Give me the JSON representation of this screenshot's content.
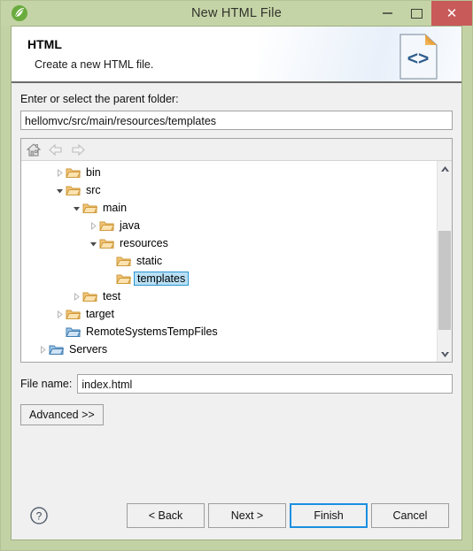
{
  "window": {
    "title": "New HTML File",
    "app_icon": "spring-leaf-icon",
    "controls": {
      "minimize": "minimize-icon",
      "maximize": "maximize-icon",
      "close": "✕"
    },
    "frame_color": "#c3d2a4",
    "titlebar_color": "#c5d4a7",
    "close_color": "#c85a5a"
  },
  "header": {
    "title": "HTML",
    "subtitle": "Create a new HTML file.",
    "icon": "html-file-icon",
    "icon_glyph": "<>"
  },
  "form": {
    "parent_folder_label": "Enter or select the parent folder:",
    "parent_folder_value": "hellomvc/src/main/resources/templates",
    "parent_folder_placeholder": "",
    "file_name_label": "File name:",
    "file_name_value": "index.html",
    "file_name_placeholder": "",
    "advanced_label": "Advanced >>"
  },
  "tree_toolbar": {
    "home": "home-icon",
    "back": "back-arrow-icon",
    "forward": "forward-arrow-icon"
  },
  "tree": {
    "selected": "templates",
    "selection_bg": "#b9e0f5",
    "selection_border": "#2b95d0",
    "items": [
      {
        "label": "bin",
        "depth": 1,
        "twisty": "collapsed",
        "folder": "orange"
      },
      {
        "label": "src",
        "depth": 1,
        "twisty": "expanded",
        "folder": "orange"
      },
      {
        "label": "main",
        "depth": 2,
        "twisty": "expanded",
        "folder": "orange"
      },
      {
        "label": "java",
        "depth": 3,
        "twisty": "collapsed",
        "folder": "orange"
      },
      {
        "label": "resources",
        "depth": 3,
        "twisty": "expanded",
        "folder": "orange"
      },
      {
        "label": "static",
        "depth": 4,
        "twisty": "none",
        "folder": "orange"
      },
      {
        "label": "templates",
        "depth": 4,
        "twisty": "none",
        "folder": "orange",
        "selected": true
      },
      {
        "label": "test",
        "depth": 2,
        "twisty": "collapsed",
        "folder": "orange"
      },
      {
        "label": "target",
        "depth": 1,
        "twisty": "collapsed",
        "folder": "orange"
      },
      {
        "label": "RemoteSystemsTempFiles",
        "depth": 1,
        "twisty": "none",
        "folder": "blue"
      },
      {
        "label": "Servers",
        "depth": 0,
        "twisty": "collapsed",
        "folder": "blue"
      }
    ]
  },
  "footer": {
    "help": "help-icon",
    "buttons": [
      {
        "label": "< Back",
        "default": false
      },
      {
        "label": "Next >",
        "default": false
      },
      {
        "label": "Finish",
        "default": true
      },
      {
        "label": "Cancel",
        "default": false
      }
    ]
  }
}
